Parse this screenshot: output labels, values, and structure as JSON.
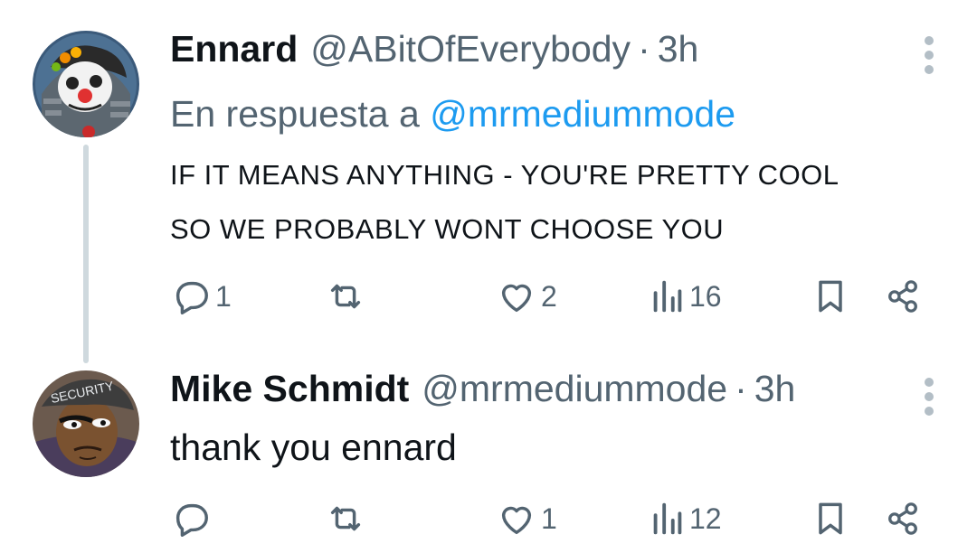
{
  "tweets": [
    {
      "author_name": "Ennard",
      "handle": "@ABitOfEverybody",
      "separator": "·",
      "time": "3h",
      "reply_prefix": "En respuesta a",
      "reply_mention": "@mrmediummode",
      "text": "IF IT MEANS ANYTHING - YOU'RE PRETTY COOL\nSO WE PROBABLY WONT CHOOSE YOU",
      "actions": {
        "replies": "1",
        "retweets": "",
        "likes": "2",
        "views": "16"
      },
      "avatar_icon": "clown-robot-avatar-icon"
    },
    {
      "author_name": "Mike Schmidt",
      "handle": "@mrmediummode",
      "separator": "·",
      "time": "3h",
      "text": "thank you ennard",
      "avatar_badge_text": "SECURITY",
      "actions": {
        "replies": "",
        "retweets": "",
        "likes": "1",
        "views": "12"
      },
      "avatar_icon": "security-guard-avatar-icon"
    }
  ],
  "colors": {
    "text": "#0f1419",
    "secondary": "#536471",
    "link": "#1d9bf0",
    "thread_line": "#cfd9de"
  }
}
